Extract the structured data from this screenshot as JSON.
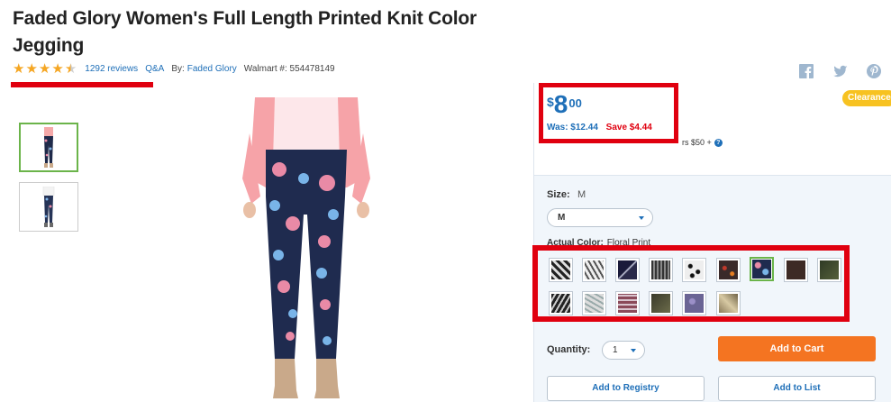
{
  "product": {
    "title": "Faded Glory Women's Full Length Printed Knit Color Jegging",
    "rating": 4.5,
    "reviews_label": "1292 reviews",
    "qa_label": "Q&A",
    "by_label": "By:",
    "brand": "Faded Glory",
    "walmart_number": "Walmart #: 554478149"
  },
  "share_icons": [
    "facebook-icon",
    "twitter-icon",
    "pinterest-icon"
  ],
  "pricing": {
    "currency": "$",
    "dollars": "8",
    "cents": "00",
    "was": "Was: $12.44",
    "save": "Save $4.44",
    "shipping_note": "rs $50 +",
    "badge": "Clearance"
  },
  "options": {
    "size_label": "Size:",
    "size_value": "M",
    "size_selected": "M",
    "color_label": "Actual Color:",
    "color_value": "Floral Print",
    "selected_swatch_index": 6,
    "swatch_count": 15
  },
  "purchase": {
    "quantity_label": "Quantity:",
    "quantity_value": "1",
    "add_to_cart": "Add to Cart",
    "add_to_registry": "Add to Registry",
    "add_to_list": "Add to List"
  },
  "colors": {
    "accent_blue": "#1e6fb8",
    "annotation_red": "#e0000f",
    "cart_orange": "#f47421",
    "clearance_yellow": "#f7c221",
    "active_green": "#6bb44a"
  }
}
